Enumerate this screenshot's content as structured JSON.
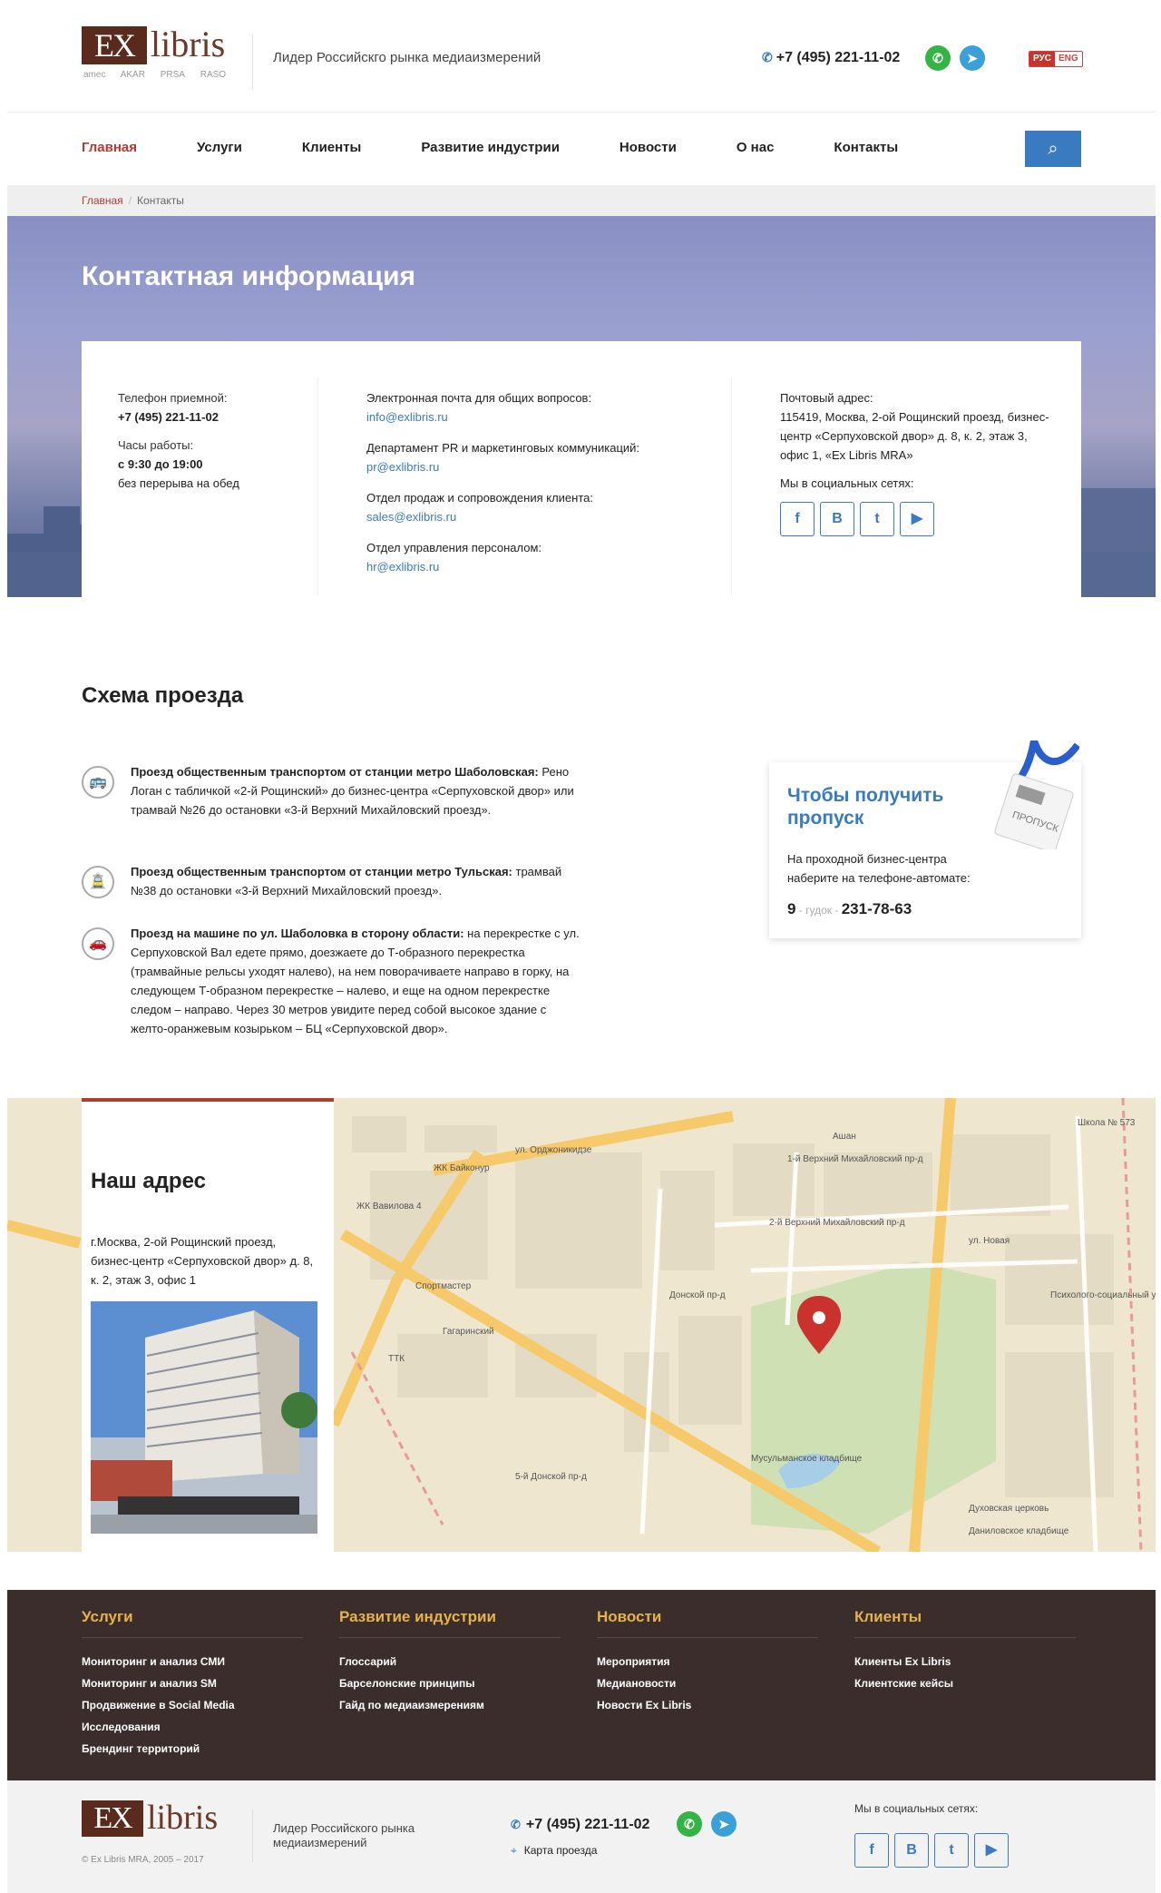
{
  "header": {
    "logo_ex": "EX",
    "logo_libris": "libris",
    "partners": [
      "amec",
      "AKAR",
      "PRSA",
      "RASO"
    ],
    "tagline": "Лидер Российскго рынка медиаизмерений",
    "phone": "+7 (495) 221-11-02",
    "lang_rus": "РУС",
    "lang_eng": "ENG"
  },
  "nav": {
    "items": [
      "Главная",
      "Услуги",
      "Клиенты",
      "Развитие индустрии",
      "Новости",
      "О нас",
      "Контакты"
    ]
  },
  "breadcrumb": {
    "home": "Главная",
    "current": "Контакты"
  },
  "hero": {
    "title": "Контактная информация"
  },
  "contacts": {
    "phone_label": "Телефон приемной:",
    "phone_value": "+7 (495) 221-11-02",
    "hours_label": "Часы работы:",
    "hours_value": "с 9:30 до 19:00",
    "hours_note": "без перерыва на обед",
    "emails": [
      {
        "label": "Электронная почта для общих вопросов:",
        "email": "info@exlibris.ru"
      },
      {
        "label": "Департамент PR и маркетинговых коммуникаций:",
        "email": "pr@exlibris.ru"
      },
      {
        "label": "Отдел продаж и сопровождения клиента:",
        "email": "sales@exlibris.ru"
      },
      {
        "label": "Отдел управления персоналом:",
        "email": "hr@exlibris.ru"
      }
    ],
    "postal_label": "Почтовый адрес:",
    "postal_value": "115419, Москва, 2-ой Рощинский проезд, бизнес-центр «Серпуховской двор» д. 8, к. 2, этаж 3, офис 1, «Ex Libris MRA»",
    "social_label": "Мы в социальных сетях:"
  },
  "directions": {
    "title": "Схема проезда",
    "routes": [
      {
        "bold": "Проезд общественным транспортом от станции метро Шаболовская:",
        "text": " Рено Логан с табличкой «2-й Рощинский» до бизнес-центра «Серпуховской двор» или трамвай №26 до остановки «3-й Верхний Михайловский проезд»."
      },
      {
        "bold": "Проезд общественным транспортом от станции метро Тульская:",
        "text": " трамвай №38 до остановки «3-й Верхний Михайловский проезд»."
      },
      {
        "bold": "Проезд на машине по ул. Шаболовка в сторону области:",
        "text": " на перекрестке с ул. Серпуховской Вал едете прямо, доезжаете до Т-образного перекрестка (трамвайные рельсы уходят налево), на нем поворачиваете направо в горку, на следующем Т-образном перекрестке – налево, и еще на одном перекрестке следом – направо. Через 30 метров увидите перед собой высокое здание с желто-оранжевым козырьком – БЦ «Серпуховской двор»."
      }
    ]
  },
  "pass": {
    "title": "Чтобы получить пропуск",
    "text": "На проходной бизнес-центра наберите на телефоне-автомате:",
    "num_prefix": "9",
    "num_middle": " - гудок - ",
    "num_main": "231-78-63",
    "badge_text": "ПРОПУСК"
  },
  "address": {
    "title": "Наш адрес",
    "text": "г.Москва, 2-ой Рощинский проезд, бизнес-центр «Серпуховской двор» д. 8, к. 2, этаж 3, офис 1"
  },
  "map_labels": [
    "ул. Орджоникидзе",
    "ЖК Байконур",
    "ЖК Вавилова 4",
    "ТТК",
    "1-й Верхний Михайловский пр-д",
    "2-й Верхний Михайловский пр-д",
    "ул. Новая",
    "Мусульманское кладбище",
    "Донской пр-д",
    "Спортмастер",
    "Гагаринский",
    "5-й Донской пр-д",
    "Духовская церковь",
    "Даниловское кладбище",
    "Психолого-социальный университет",
    "Школа № 573",
    "Ашан"
  ],
  "footer": {
    "cols": [
      {
        "title": "Услуги",
        "links": [
          "Мониторинг и анализ СМИ",
          "Мониторинг и анализ SM",
          "Продвижение в Social Media",
          "Исследования",
          "Брендинг территорий"
        ]
      },
      {
        "title": "Развитие индустрии",
        "links": [
          "Глоссарий",
          "Барселонские принципы",
          "Гайд по медиаизмерениям"
        ]
      },
      {
        "title": "Новости",
        "links": [
          "Мероприятия",
          "Медиановости",
          "Новости Ex Libris"
        ]
      },
      {
        "title": "Клиенты",
        "links": [
          "Клиенты Ex Libris",
          "Клиентские кейсы"
        ]
      }
    ],
    "copyright": "© Ex Libris MRA, 2005 – 2017",
    "tagline": "Лидер Российского рынка медиаизмерений",
    "phone": "+7 (495) 221-11-02",
    "map_link": "Карта проезда",
    "social_label": "Мы в социальных сетях:"
  },
  "colors": {
    "accent": "#b23a31",
    "blue": "#3a7ac0",
    "footer_bg": "#3a2d2b",
    "footer_heading": "#e6b24a"
  }
}
